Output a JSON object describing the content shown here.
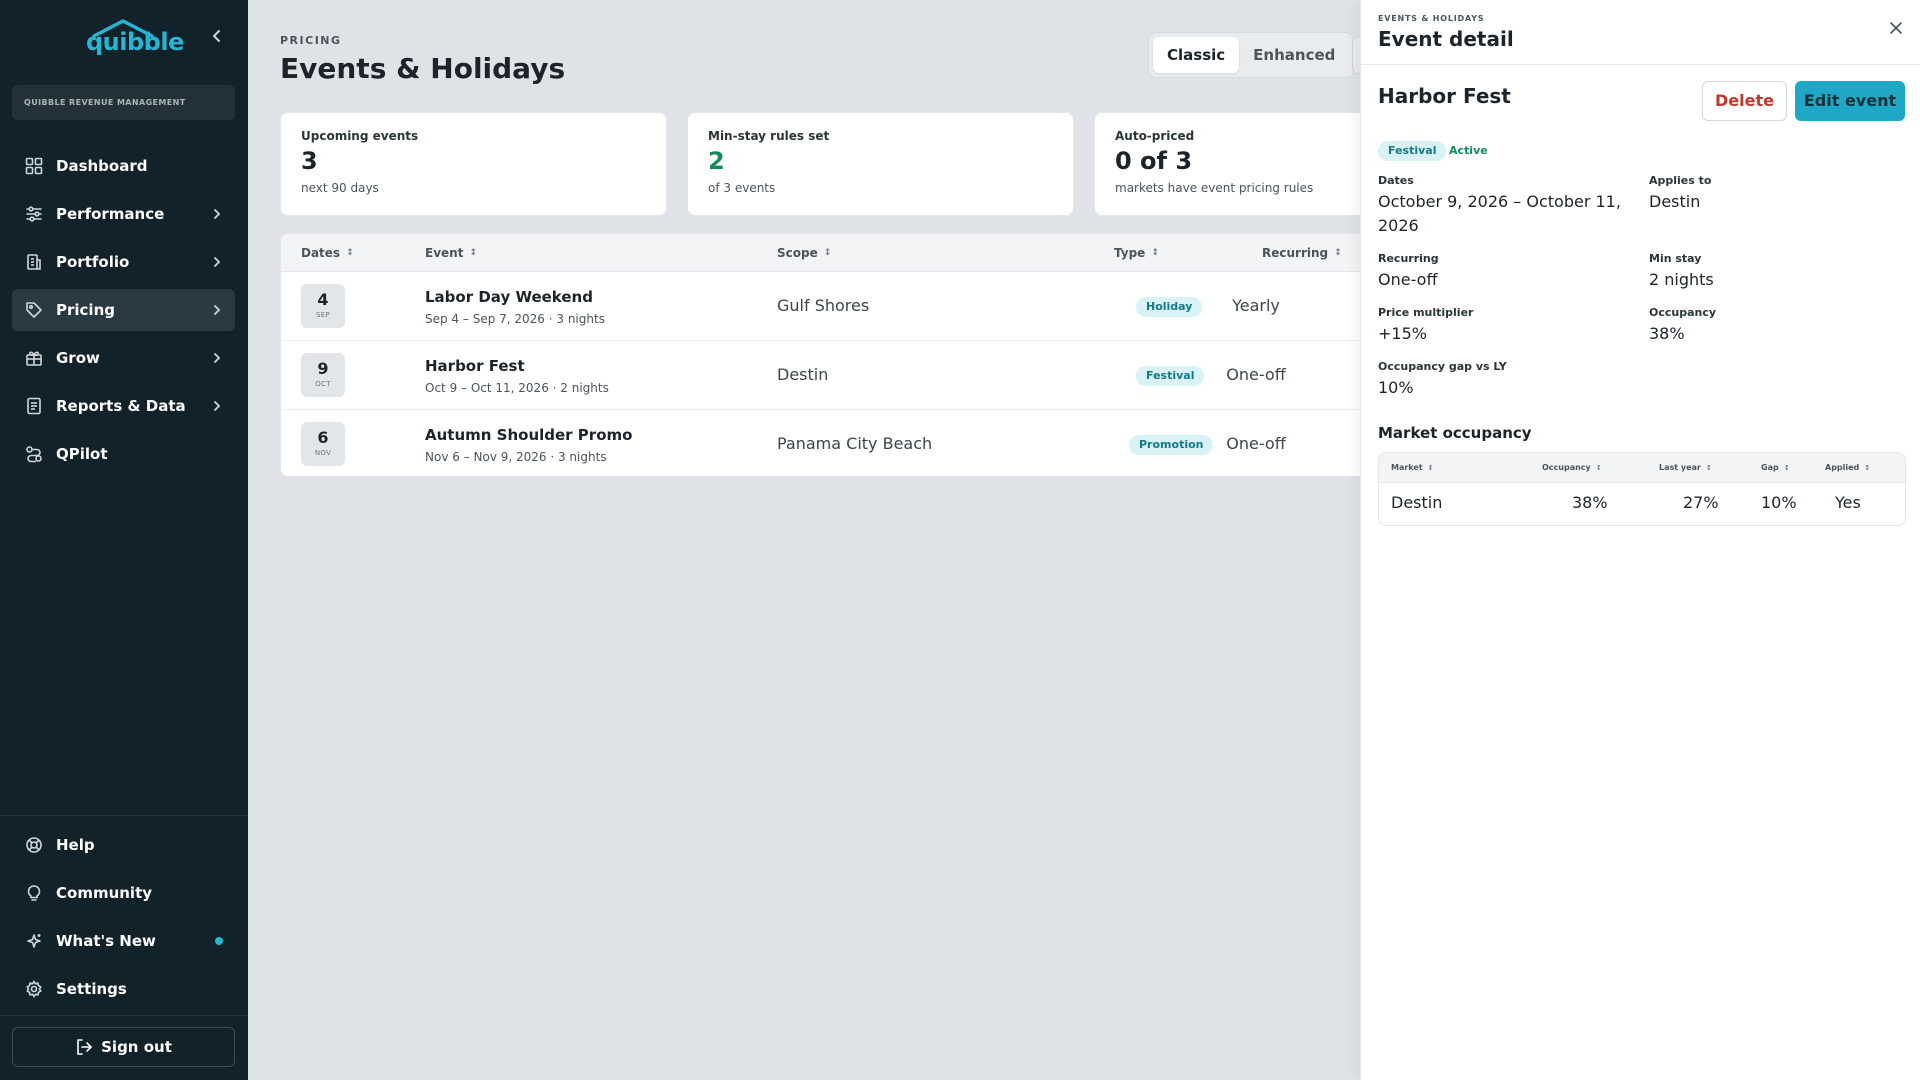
{
  "sidebar": {
    "logo_text": "quibble",
    "org_label": "QUIBBLE REVENUE MANAGEMENT",
    "nav_items": [
      {
        "label": "Dashboard",
        "icon": "grid-icon"
      },
      {
        "label": "Performance",
        "icon": "sliders-icon"
      },
      {
        "label": "Portfolio",
        "icon": "building-icon"
      },
      {
        "label": "Pricing",
        "icon": "tag-icon",
        "active": true
      },
      {
        "label": "Grow",
        "icon": "gift-icon"
      },
      {
        "label": "Reports & Data",
        "icon": "report-icon"
      },
      {
        "label": "QPilot",
        "icon": "route-icon"
      }
    ],
    "bottom_items": [
      {
        "label": "Help",
        "icon": "lifebuoy-icon"
      },
      {
        "label": "Community",
        "icon": "lightbulb-icon"
      },
      {
        "label": "What's New",
        "icon": "sparkle-icon"
      },
      {
        "label": "Settings",
        "icon": "gear-icon"
      }
    ],
    "signout_label": "Sign out"
  },
  "header": {
    "eyebrow": "PRICING",
    "title": "Events & Holidays",
    "toggle": [
      "Classic",
      "Enhanced"
    ],
    "toggle_selected": "Classic"
  },
  "stats": [
    {
      "label": "Upcoming events",
      "value": "3",
      "sub": "next 90 days"
    },
    {
      "label": "Min-stay rules set",
      "value": "2",
      "sub": "of 3 events"
    },
    {
      "label": "Auto-priced",
      "value": "0 of 3",
      "sub": "markets have event pricing rules"
    }
  ],
  "table": {
    "columns": [
      "Dates",
      "Event",
      "Scope",
      "Type",
      "Recurring"
    ],
    "rows": [
      {
        "day": "4",
        "month": "SEP",
        "name": "Labor Day Weekend",
        "sub": "Sep 4 – Sep 7, 2026 · 3 nights",
        "scope": "Gulf Shores",
        "type": "Holiday",
        "recurring": "Yearly"
      },
      {
        "day": "9",
        "month": "OCT",
        "name": "Harbor Fest",
        "sub": "Oct 9 – Oct 11, 2026 · 2 nights",
        "scope": "Destin",
        "type": "Festival",
        "recurring": "One-off"
      },
      {
        "day": "6",
        "month": "NOV",
        "name": "Autumn Shoulder Promo",
        "sub": "Nov 6 – Nov 9, 2026 · 3 nights",
        "scope": "Panama City Beach",
        "type": "Promotion",
        "recurring": "One-off"
      }
    ]
  },
  "panel": {
    "eyebrow": "EVENTS & HOLIDAYS",
    "title": "Event detail",
    "event_name": "Harbor Fest",
    "delete_label": "Delete",
    "edit_label": "Edit event",
    "type_badge": "Festival",
    "status": "Active",
    "fields": {
      "dates_label": "Dates",
      "dates_value": "October 9, 2026 – October 11, 2026",
      "applies_label": "Applies to",
      "applies_value": "Destin",
      "recurring_label": "Recurring",
      "recurring_value": "One-off",
      "minstay_label": "Min stay",
      "minstay_value": "2 nights",
      "multiplier_label": "Price multiplier",
      "multiplier_value": "+15%",
      "occupancy_label": "Occupancy",
      "occupancy_value": "38%",
      "gap_label": "Occupancy gap vs LY",
      "gap_value": "10%"
    },
    "market_title": "Market occupancy",
    "market_columns": [
      "Market",
      "Occupancy",
      "Last year",
      "Gap",
      "Applied"
    ],
    "market_rows": [
      {
        "market": "Destin",
        "occupancy": "38%",
        "last_year": "27%",
        "gap": "10%",
        "applied": "Yes"
      }
    ]
  },
  "colors": {
    "sidebar_bg": "#12222a",
    "accent": "#1fa8c6",
    "green": "#148a5a",
    "danger": "#c0392b"
  }
}
